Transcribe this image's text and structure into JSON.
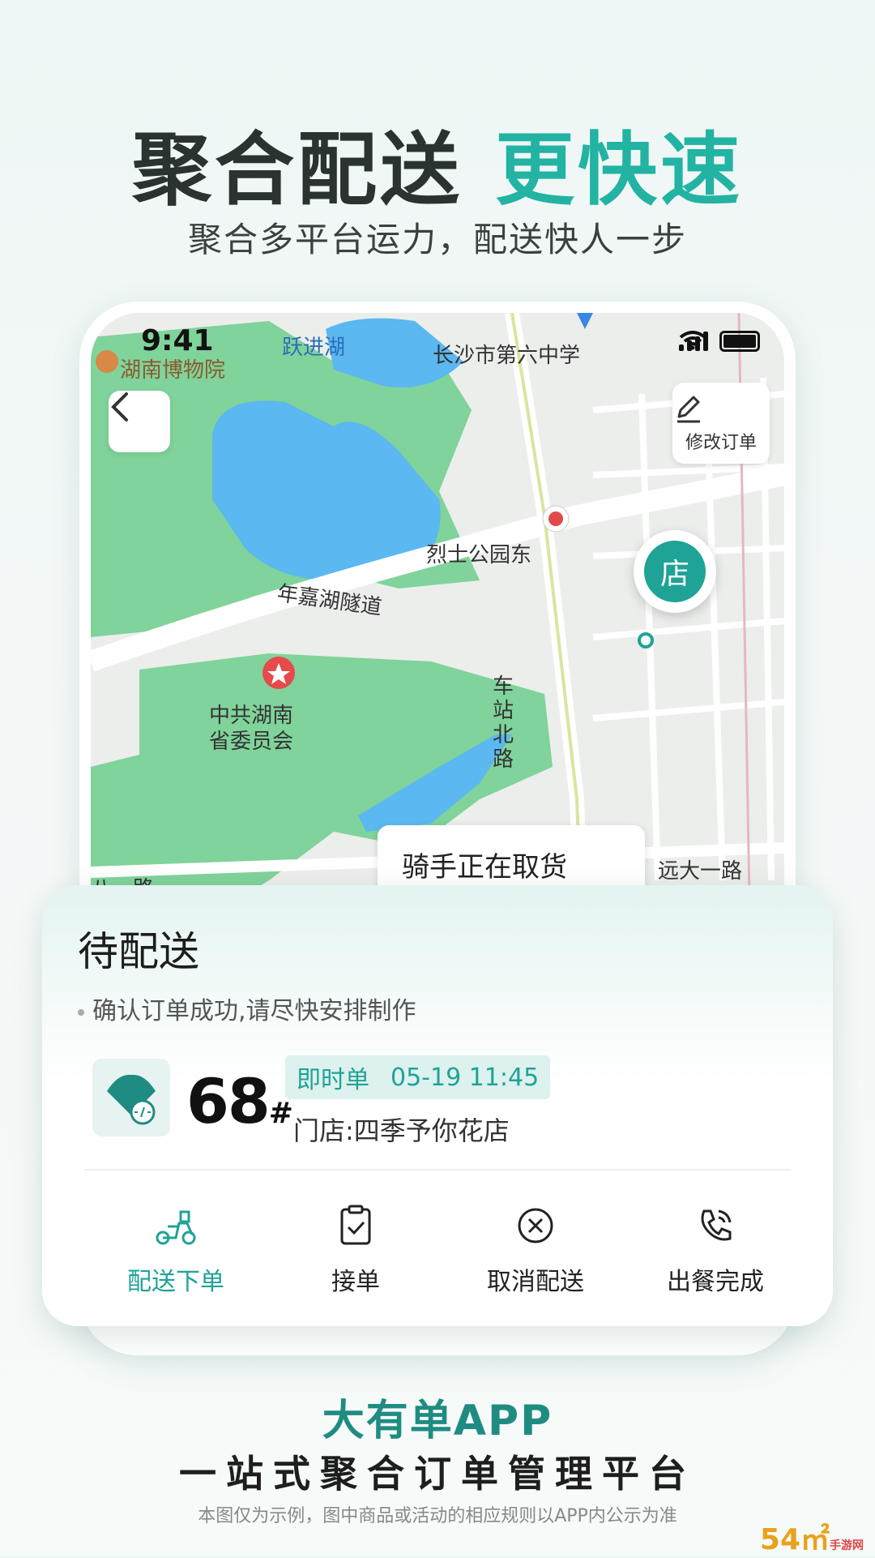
{
  "headline": {
    "part1": "聚合配送",
    "part2": "更快速"
  },
  "subheadline": "聚合多平台运力，配送快人一步",
  "status_bar": {
    "time": "9:41"
  },
  "map": {
    "labels": {
      "lake": "跃进湖",
      "school": "长沙市第六中学",
      "museum": "湖南博物院",
      "station": "烈士公园东",
      "tunnel": "年嘉湖隧道",
      "gov_line1": "中共湖南",
      "gov_line2": "省委员会",
      "road_north": "车站北路",
      "road_east": "远大一路",
      "road_sw": "八一路"
    },
    "edit_order_label": "修改订单",
    "store_pin_label": "店",
    "rider_status": "骑手正在取货"
  },
  "order_card": {
    "status_title": "待配送",
    "note": "确认订单成功,请尽快安排制作",
    "order_number": "68",
    "order_suffix": "#",
    "order_type": "即时单",
    "order_time": "05-19 11:45",
    "store": "门店:四季予你花店",
    "actions": [
      {
        "label": "配送下单",
        "icon": "scooter-icon",
        "active": true
      },
      {
        "label": "接单",
        "icon": "clipboard-check-icon",
        "active": false
      },
      {
        "label": "取消配送",
        "icon": "cancel-circle-icon",
        "active": false
      },
      {
        "label": "出餐完成",
        "icon": "phone-call-icon",
        "active": false
      }
    ]
  },
  "brand_name": "大有单APP",
  "slogan": "一站式聚合订单管理平台",
  "disclaimer": "本图仅为示例，图中商品或活动的相应规则以APP内公示为准",
  "watermark": {
    "main": "54㎡",
    "sub": "手游网"
  },
  "colors": {
    "accent": "#22b3a3",
    "teal_dark": "#1fa397",
    "water": "#5bb8f0",
    "park": "#7fd49b"
  }
}
